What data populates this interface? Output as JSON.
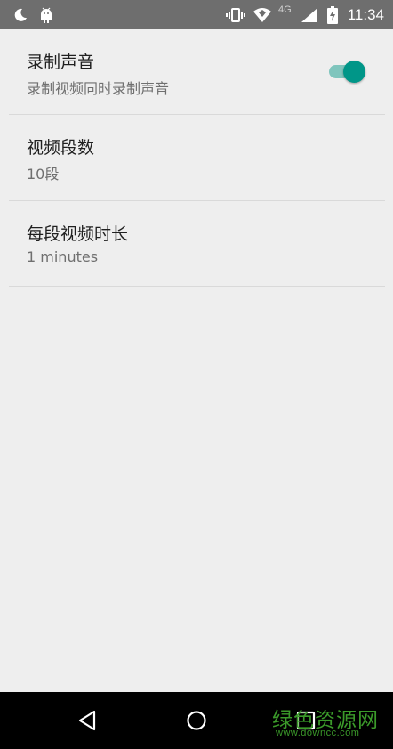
{
  "status_bar": {
    "time": "11:34",
    "network": "4G",
    "icons": [
      "moon-icon",
      "android-icon",
      "vibrate-icon",
      "wifi-icon",
      "signal-icon",
      "battery-charging-icon"
    ]
  },
  "settings": {
    "items": [
      {
        "title": "录制声音",
        "summary": "录制视频同时录制声音",
        "toggle": true
      },
      {
        "title": "视频段数",
        "summary": "10段"
      },
      {
        "title": "每段视频时长",
        "summary": "1 minutes"
      }
    ]
  },
  "nav_bar": {
    "icons": [
      "back-icon",
      "home-icon",
      "recents-icon"
    ]
  },
  "watermark": {
    "text": "绿色资源网",
    "url": "www.downcc.com"
  },
  "colors": {
    "accent": "#009688",
    "accent_track": "#7fc5bd",
    "status_bar": "#6e6e6e",
    "background": "#eeeeee"
  }
}
